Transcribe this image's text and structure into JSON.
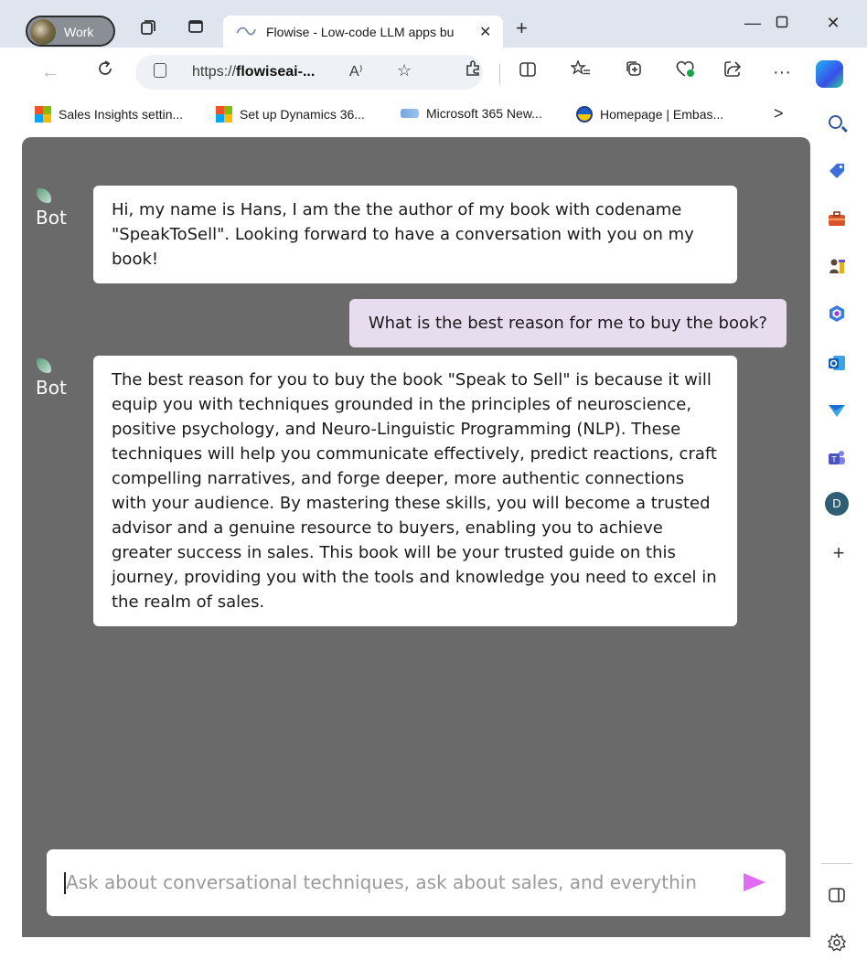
{
  "browser": {
    "profile_label": "Work",
    "tab_title": "Flowise - Low-code LLM apps bu",
    "url_prefix": "https://",
    "url_host": "flowiseai-...",
    "read_aloud_label": "A⁾"
  },
  "bookmarks": [
    {
      "label": "Sales Insights settin..."
    },
    {
      "label": "Set up Dynamics 36..."
    },
    {
      "label": "Microsoft 365 New..."
    },
    {
      "label": "Homepage | Embas..."
    }
  ],
  "chat": {
    "bot_avatar_alt": "Bot",
    "messages": [
      {
        "role": "bot",
        "text": "Hi, my name is Hans, I am the the author of my book with codename \"SpeakToSell\". Looking forward to have a conversation with you on my book!"
      },
      {
        "role": "user",
        "text": "What is the best reason for me to buy the book?"
      },
      {
        "role": "bot",
        "text": "The best reason for you to buy the book \"Speak to Sell\" is because it will equip you with techniques grounded in the principles of neuroscience, positive psychology, and Neuro-Linguistic Programming (NLP). These techniques will help you communicate effectively, predict reactions, craft compelling narratives, and forge deeper, more authentic connections with your audience. By mastering these skills, you will become a trusted advisor and a genuine resource to buyers, enabling you to achieve greater success in sales. This book will be your trusted guide on this journey, providing you with the tools and knowledge you need to excel in the realm of sales."
      }
    ],
    "input_placeholder": "Ask about conversational techniques, ask about sales, and everything else you want to know"
  },
  "sidebar_icons": [
    "search-icon",
    "tag-icon",
    "toolbox-icon",
    "chess-icon",
    "microsoft365-icon",
    "outlook-icon",
    "send-icon",
    "teams-icon",
    "profile-d-icon",
    "add-icon",
    "split-screen-icon",
    "settings-icon"
  ],
  "sidebar_profile_letter": "D",
  "colors": {
    "chat_background": "#6a6a6a",
    "user_bubble": "#e8dcef",
    "send_button": "#e26cf1"
  }
}
